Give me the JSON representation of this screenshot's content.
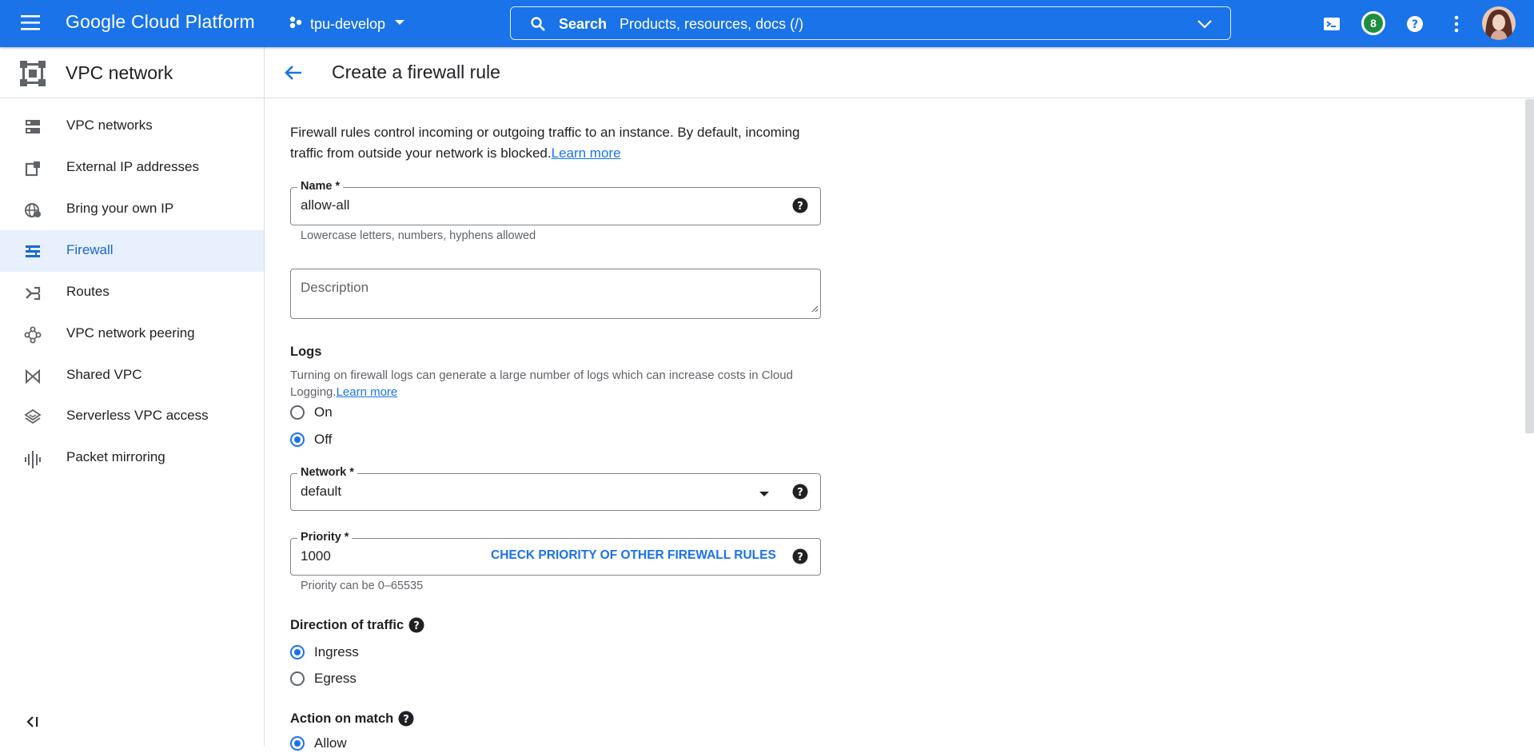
{
  "topbar": {
    "brand": "Google Cloud Platform",
    "project": "tpu-develop",
    "search_label": "Search",
    "search_placeholder": "Products, resources, docs (/)",
    "notification_count": "8",
    "accent_color": "#1a73e8"
  },
  "sidebar": {
    "title": "VPC network",
    "items": [
      {
        "label": "VPC networks",
        "icon": "vpc-networks-icon"
      },
      {
        "label": "External IP addresses",
        "icon": "external-ip-icon"
      },
      {
        "label": "Bring your own IP",
        "icon": "globe-icon"
      },
      {
        "label": "Firewall",
        "icon": "firewall-icon",
        "active": true
      },
      {
        "label": "Routes",
        "icon": "routes-icon"
      },
      {
        "label": "VPC network peering",
        "icon": "peering-icon"
      },
      {
        "label": "Shared VPC",
        "icon": "shared-vpc-icon"
      },
      {
        "label": "Serverless VPC access",
        "icon": "serverless-icon"
      },
      {
        "label": "Packet mirroring",
        "icon": "packet-mirroring-icon"
      }
    ]
  },
  "page": {
    "title": "Create a firewall rule",
    "intro": "Firewall rules control incoming or outgoing traffic to an instance. By default, incoming traffic from outside your network is blocked.",
    "learn_more": "Learn more"
  },
  "form": {
    "name": {
      "label": "Name *",
      "value": "allow-all",
      "hint": "Lowercase letters, numbers, hyphens allowed"
    },
    "description": {
      "placeholder": "Description"
    },
    "logs": {
      "title": "Logs",
      "desc": "Turning on firewall logs can generate a large number of logs which can increase costs in Cloud Logging.",
      "learn_more": "Learn more",
      "options": [
        "On",
        "Off"
      ],
      "selected": "Off"
    },
    "network": {
      "label": "Network *",
      "value": "default"
    },
    "priority": {
      "label": "Priority *",
      "value": "1000",
      "action": "CHECK PRIORITY OF OTHER FIREWALL RULES",
      "hint": "Priority can be 0–65535"
    },
    "direction": {
      "title": "Direction of traffic",
      "options": [
        "Ingress",
        "Egress"
      ],
      "selected": "Ingress"
    },
    "action": {
      "title": "Action on match",
      "options": [
        "Allow"
      ],
      "selected": "Allow"
    }
  }
}
